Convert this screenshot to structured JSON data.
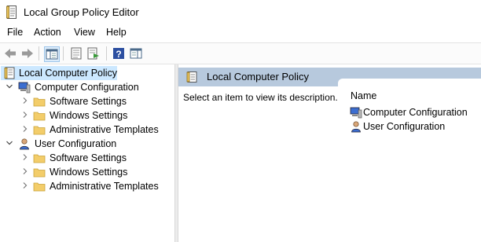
{
  "window": {
    "title": "Local Group Policy Editor"
  },
  "menu": [
    "File",
    "Action",
    "View",
    "Help"
  ],
  "toolbar": {
    "buttons": [
      "back-icon",
      "forward-icon",
      "show-hide-console-tree-icon",
      "export-list-icon",
      "properties-icon",
      "help-icon",
      "show-action-pane-icon"
    ]
  },
  "tree": {
    "root": {
      "label": "Local Computer Policy",
      "icon": "policy-document-icon",
      "selected": true
    },
    "nodes": [
      {
        "label": "Computer Configuration",
        "icon": "computer-icon",
        "expanded": true,
        "children": [
          "Software Settings",
          "Windows Settings",
          "Administrative Templates"
        ]
      },
      {
        "label": "User Configuration",
        "icon": "user-icon",
        "expanded": true,
        "children": [
          "Software Settings",
          "Windows Settings",
          "Administrative Templates"
        ]
      }
    ]
  },
  "details": {
    "header": "Local Computer Policy",
    "description": "Select an item to view its description.",
    "column_name": "Name",
    "items": [
      {
        "label": "Computer Configuration",
        "icon": "computer-icon"
      },
      {
        "label": "User Configuration",
        "icon": "user-icon"
      }
    ]
  },
  "colors": {
    "selection": "#cce8ff",
    "header_band": "#b7c9dd",
    "folder": "#f3cd6a"
  }
}
